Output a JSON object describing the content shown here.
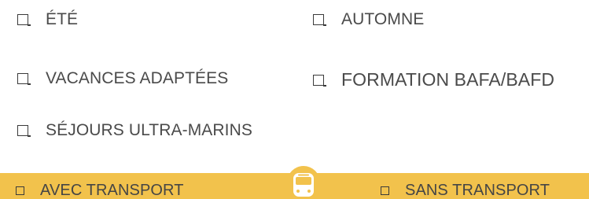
{
  "colors": {
    "accent": "#f2c24c",
    "text": "#4a4a4a",
    "checkbox_border": "#3a3a3a"
  },
  "seasons": {
    "ete": "ÉTÉ",
    "automne": "AUTOMNE",
    "vacances_adaptees": "VACANCES ADAPTÉES",
    "formation": "FORMATION BAFA/BAFD",
    "sejours_ultra_marins": "SÉJOURS ULTRA-MARINS"
  },
  "transport": {
    "avec": "AVEC TRANSPORT",
    "sans": "SANS TRANSPORT",
    "icon": "bus-icon"
  }
}
